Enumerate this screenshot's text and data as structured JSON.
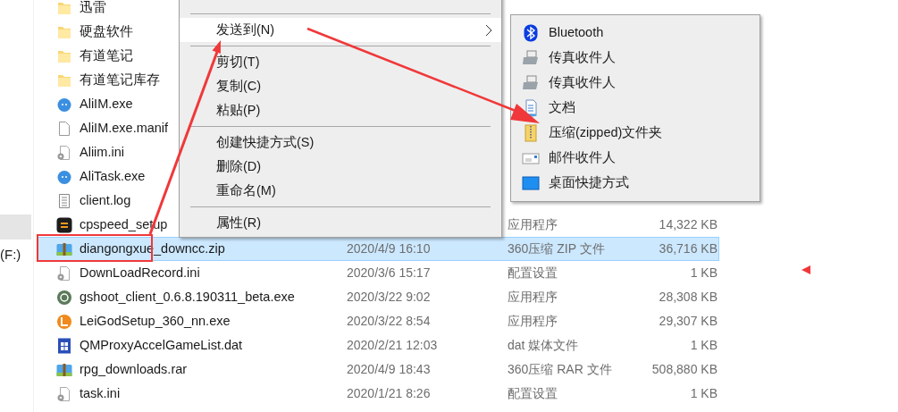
{
  "nav": {
    "items": [
      {
        "label": "(F:)"
      }
    ]
  },
  "files": [
    {
      "name": "迅雷",
      "kind": "folder",
      "selected": false
    },
    {
      "name": "硬盘软件",
      "kind": "folder",
      "selected": false
    },
    {
      "name": "有道笔记",
      "kind": "folder",
      "selected": false
    },
    {
      "name": "有道笔记库存",
      "kind": "folder",
      "selected": false
    },
    {
      "name": "AliIM.exe",
      "kind": "chat",
      "selected": false
    },
    {
      "name": "AliIM.exe.manif",
      "kind": "blank",
      "selected": false
    },
    {
      "name": "Aliim.ini",
      "kind": "settings",
      "selected": false
    },
    {
      "name": "AliTask.exe",
      "kind": "chat",
      "selected": false
    },
    {
      "name": "client.log",
      "kind": "text",
      "selected": false
    },
    {
      "name": "cpspeed_setup",
      "kind": "speed",
      "type": "应用程序",
      "size": "14,322 KB",
      "selected": false
    },
    {
      "name": "diangongxue_downcc.zip",
      "kind": "archive",
      "date": "2020/4/9 16:10",
      "type": "360压缩 ZIP 文件",
      "size": "36,716 KB",
      "selected": true
    },
    {
      "name": "DownLoadRecord.ini",
      "kind": "settings",
      "date": "2020/3/6 15:17",
      "type": "配置设置",
      "size": "1 KB",
      "selected": false
    },
    {
      "name": "gshoot_client_0.6.8.190311_beta.exe",
      "kind": "gshoot",
      "date": "2020/3/22 9:02",
      "type": "应用程序",
      "size": "28,308 KB",
      "selected": false
    },
    {
      "name": "LeiGodSetup_360_nn.exe",
      "kind": "leigod",
      "date": "2020/3/22 8:54",
      "type": "应用程序",
      "size": "29,307 KB",
      "selected": false
    },
    {
      "name": "QMProxyAccelGameList.dat",
      "kind": "film",
      "date": "2020/2/21 12:03",
      "type": "dat 媒体文件",
      "size": "1 KB",
      "selected": false
    },
    {
      "name": "rpg_downloads.rar",
      "kind": "archive",
      "date": "2020/4/9 18:43",
      "type": "360压缩 RAR 文件",
      "size": "508,880 KB",
      "selected": false
    },
    {
      "name": "task.ini",
      "kind": "settings",
      "date": "2020/1/21 8:26",
      "type": "配置设置",
      "size": "1 KB",
      "selected": false
    }
  ],
  "context_menu": {
    "items": [
      {
        "kind": "divider"
      },
      {
        "kind": "item",
        "label": "发送到(N)",
        "highlighted": true,
        "submenu": true
      },
      {
        "kind": "divider"
      },
      {
        "kind": "item",
        "label": "剪切(T)",
        "highlighted": false,
        "submenu": false
      },
      {
        "kind": "item",
        "label": "复制(C)",
        "highlighted": false,
        "submenu": false
      },
      {
        "kind": "item",
        "label": "粘贴(P)",
        "highlighted": false,
        "submenu": false
      },
      {
        "kind": "divider"
      },
      {
        "kind": "item",
        "label": "创建快捷方式(S)",
        "highlighted": false,
        "submenu": false
      },
      {
        "kind": "item",
        "label": "删除(D)",
        "highlighted": false,
        "submenu": false
      },
      {
        "kind": "item",
        "label": "重命名(M)",
        "highlighted": false,
        "submenu": false
      },
      {
        "kind": "divider"
      },
      {
        "kind": "item",
        "label": "属性(R)",
        "highlighted": false,
        "submenu": false
      }
    ]
  },
  "send_to_menu": {
    "items": [
      {
        "label": "Bluetooth",
        "kind": "bluetooth"
      },
      {
        "label": "传真收件人",
        "kind": "fax"
      },
      {
        "label": "传真收件人",
        "kind": "fax"
      },
      {
        "label": "文档",
        "kind": "document"
      },
      {
        "label": "压缩(zipped)文件夹",
        "kind": "zip"
      },
      {
        "label": "邮件收件人",
        "kind": "mail"
      },
      {
        "label": "桌面快捷方式",
        "kind": "desktop"
      }
    ]
  }
}
